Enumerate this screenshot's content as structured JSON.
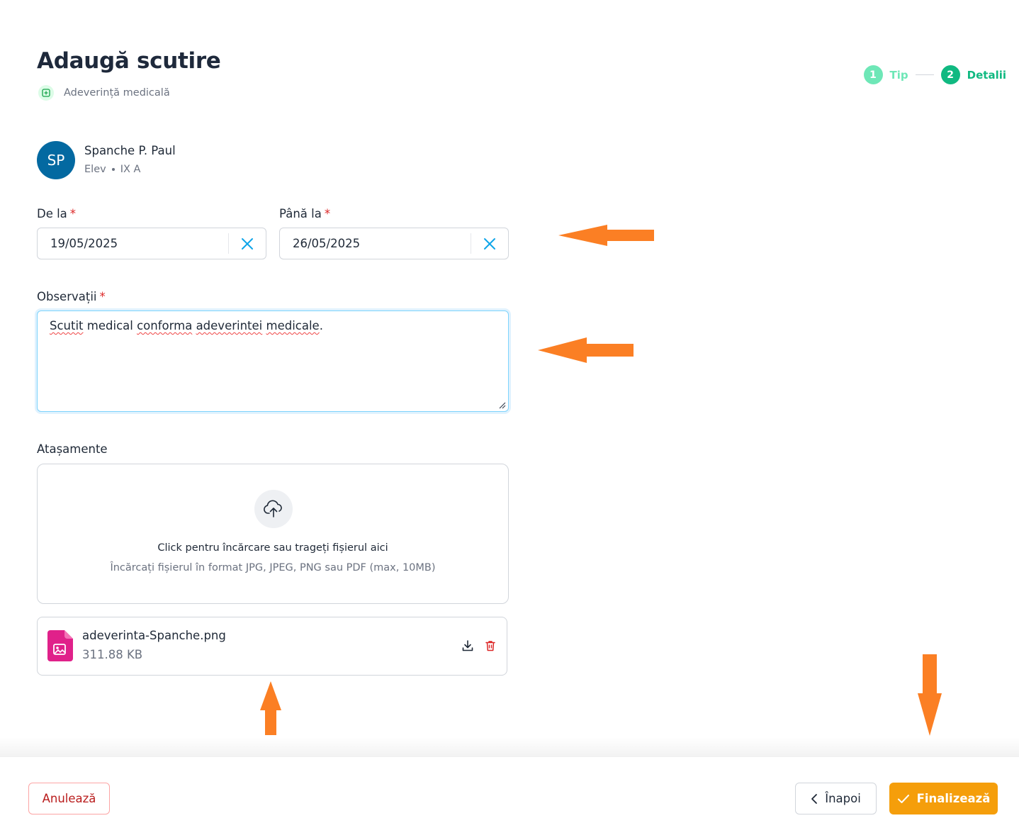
{
  "header": {
    "title": "Adaugă scutire",
    "subtitle": "Adeverință medicală"
  },
  "stepper": {
    "steps": [
      {
        "number": "1",
        "label": "Tip"
      },
      {
        "number": "2",
        "label": "Detalii"
      }
    ]
  },
  "person": {
    "initials": "SP",
    "name": "Spanche P. Paul",
    "role": "Elev",
    "class": "IX A"
  },
  "form": {
    "from_label": "De la",
    "to_label": "Până la",
    "required_mark": "*",
    "from_value": "19/05/2025",
    "to_value": "26/05/2025",
    "notes_label": "Observații",
    "notes_words": [
      "Scutit",
      "medical",
      "conforma",
      "adeverintei",
      "medicale"
    ],
    "notes_end": "."
  },
  "attachments": {
    "label": "Atașamente",
    "upload_title": "Click pentru încărcare sau trageți fișierul aici",
    "upload_hint": "Încărcați fișierul în format JPG, JPEG, PNG sau PDF (max, 10MB)",
    "file_name": "adeverinta-Spanche.png",
    "file_size": "311.88 KB"
  },
  "footer": {
    "cancel_label": "Anulează",
    "back_label": "Înapoi",
    "finish_label": "Finalizează"
  },
  "colors": {
    "accent_orange": "#f59e0b",
    "annotation_orange": "#fb7f24",
    "step_done": "#6ee7b7",
    "step_active": "#10b981",
    "avatar": "#0369a1",
    "danger": "#b91c1c"
  },
  "icons": [
    "medical-plus-icon",
    "close-icon",
    "upload-cloud-icon",
    "image-file-icon",
    "download-icon",
    "trash-icon",
    "chevron-left-icon",
    "check-icon",
    "arrow-annotation"
  ]
}
